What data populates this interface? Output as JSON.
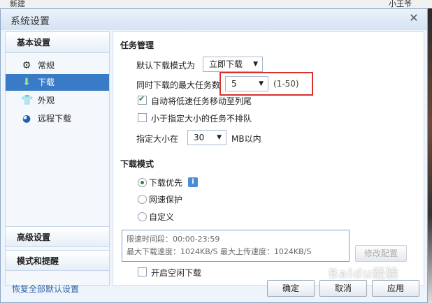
{
  "background": {
    "toolbar_new": "新建",
    "toolbar_user": "小王爷"
  },
  "dialog": {
    "title": "系统设置"
  },
  "sidebar": {
    "basic_settings": "基本设置",
    "items": [
      {
        "label": "常规",
        "icon": "gear-icon"
      },
      {
        "label": "下载",
        "icon": "download-icon",
        "selected": true
      },
      {
        "label": "外观",
        "icon": "shirt-icon"
      },
      {
        "label": "远程下载",
        "icon": "remote-icon"
      }
    ],
    "advanced_settings": "高级设置",
    "modes_alerts": "模式和提醒"
  },
  "task_management": {
    "title": "任务管理",
    "default_mode_label": "默认下载模式为",
    "default_mode_value": "立即下载",
    "max_tasks_label": "同时下载的最大任务数",
    "max_tasks_value": "5",
    "max_tasks_range": "(1-50)",
    "auto_move_label": "自动将低速任务移动至列尾",
    "auto_move_checked": true,
    "no_queue_small_label": "小于指定大小的任务不排队",
    "no_queue_small_checked": false,
    "size_prefix": "指定大小在",
    "size_value": "30",
    "size_suffix": "MB以内"
  },
  "download_mode": {
    "title": "下载模式",
    "options": [
      {
        "label": "下载优先",
        "checked": true
      },
      {
        "label": "网速保护",
        "checked": false
      },
      {
        "label": "自定义",
        "checked": false
      }
    ],
    "limit_period": "限速时间段：00:00-23:59",
    "limit_speeds": "最大下载速度：1024KB/S  最大上传速度：1024KB/S",
    "modify_config": "修改配置",
    "idle_download_label": "开启空闲下载",
    "idle_download_checked": false
  },
  "footer": {
    "restore_defaults": "恢复全部默认设置",
    "ok": "确定",
    "cancel": "取消",
    "apply": "应用"
  },
  "watermark": "Baidu经验"
}
